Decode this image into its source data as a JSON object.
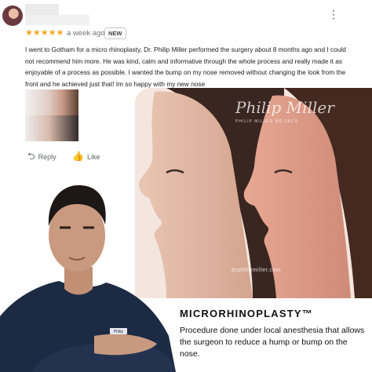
{
  "review": {
    "more_icon": "more-vert-icon",
    "stars": "★★★★★",
    "rating": 5,
    "time": "a week ago",
    "badge": "NEW",
    "text": "I went to Gotham for a micro rhinoplasty, Dr. Philip Miller performed the surgery about 8 months ago and I could not recommend him more. He was kind, calm and informative through the whole process and really made it as enjoyable of a process as possible. I wanted the bump on my nose removed without changing the look from the front and he achieved just that! Im so happy with my new nose",
    "actions": {
      "reply": "Reply",
      "like": "Like"
    }
  },
  "photo": {
    "watermark_signature": "Philip Miller",
    "watermark_sub": "PHILIP MILLER MD FACS",
    "watermark_site": "drphilipmiller.com"
  },
  "doctor": {
    "badge": "Philip"
  },
  "caption": {
    "title": "MICRORHINOPLASTY™",
    "body": "Procedure done under local anesthesia that allows the surgeon to reduce a hump or bump on the nose."
  },
  "colors": {
    "star": "#f5a623",
    "muted": "#5f6368",
    "text": "#202124"
  }
}
